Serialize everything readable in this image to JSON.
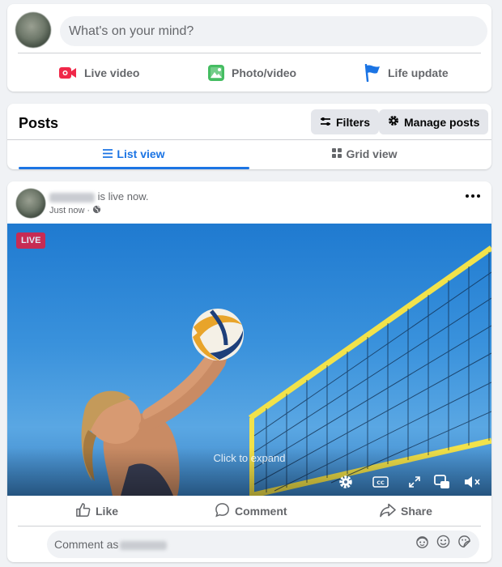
{
  "composer": {
    "placeholder": "What's on your mind?",
    "actions": [
      {
        "label": "Live video",
        "icon": "live-video-icon",
        "color": "#f02849"
      },
      {
        "label": "Photo/video",
        "icon": "photo-icon",
        "color": "#45bd62"
      },
      {
        "label": "Life update",
        "icon": "flag-icon",
        "color": "#1b74e4"
      }
    ]
  },
  "posts_header": {
    "title": "Posts",
    "filters_label": "Filters",
    "manage_label": "Manage posts",
    "tabs": [
      {
        "label": "List view",
        "active": true
      },
      {
        "label": "Grid view",
        "active": false
      }
    ],
    "accent_color": "#1b74e4"
  },
  "post": {
    "status_text": "is live now.",
    "timestamp": "Just now",
    "audience_icon": "globe-icon",
    "live_badge": "LIVE",
    "video_overlay_text": "Click to expand",
    "video_controls": [
      "settings-icon",
      "captions-icon",
      "fullscreen-icon",
      "pip-icon",
      "mute-icon"
    ],
    "actions": [
      {
        "label": "Like",
        "icon": "like-icon"
      },
      {
        "label": "Comment",
        "icon": "comment-icon"
      },
      {
        "label": "Share",
        "icon": "share-icon"
      }
    ],
    "comment_placeholder": "Comment as",
    "comment_icons": [
      "avatar-sticker-icon",
      "emoji-icon",
      "sticker-icon"
    ]
  }
}
